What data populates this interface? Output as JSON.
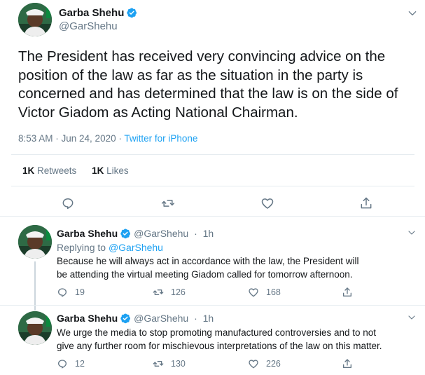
{
  "main_tweet": {
    "author_name": "Garba Shehu",
    "author_handle": "@GarShehu",
    "text": "The President has received very convincing advice on the position of the law as far as the situation in the party is concerned and has determined that the law is on the side of Victor Giadom as Acting National Chairman.",
    "timestamp": "8:53 AM · Jun 24, 2020",
    "source_sep": " · ",
    "source": "Twitter for iPhone",
    "retweets_count": "1K",
    "retweets_label": "Retweets",
    "likes_count": "1K",
    "likes_label": "Likes"
  },
  "replies": [
    {
      "author_name": "Garba Shehu",
      "author_handle": "@GarShehu",
      "time_sep": "·",
      "time": "1h",
      "replying_to_label": "Replying to",
      "replying_to_handle": "@GarShehu",
      "text": "Because he will always act in accordance with the law, the President will be attending the virtual meeting Giadom called for tomorrow afternoon.",
      "reply_count": "19",
      "retweet_count": "126",
      "like_count": "168"
    },
    {
      "author_name": "Garba Shehu",
      "author_handle": "@GarShehu",
      "time_sep": "·",
      "time": "1h",
      "text": "We urge the media to stop promoting manufactured controversies and to not give any further room for mischievous interpretations of the law on this matter.",
      "reply_count": "12",
      "retweet_count": "130",
      "like_count": "226"
    }
  ],
  "icons": {
    "verified": "verified-badge-icon",
    "reply": "reply-icon",
    "retweet": "retweet-icon",
    "like": "heart-icon",
    "share": "share-icon",
    "more": "chevron-down-icon"
  },
  "colors": {
    "accent": "#1da1f2",
    "text_primary": "#14171a",
    "text_secondary": "#657786",
    "border": "#e6ecf0"
  }
}
